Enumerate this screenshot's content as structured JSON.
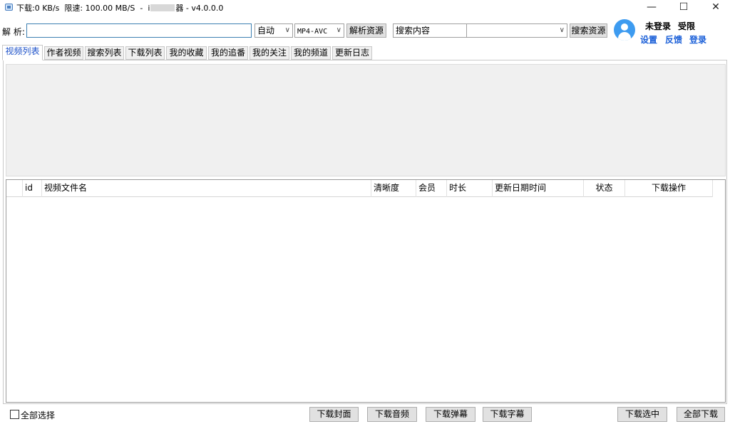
{
  "titlebar": {
    "download_label": "下载:0 KB/s",
    "limit_label": "限速: 100.00 MB/S",
    "sep": "-",
    "name_prefix": "i",
    "name_suffix": "器",
    "version": "- v4.0.0.0",
    "minimize_glyph": "—",
    "maximize_glyph": "☐",
    "close_glyph": "✕"
  },
  "parse": {
    "label": "解 析:",
    "url_value": "",
    "mode_value": "自动",
    "format_value": "MP4-AVC",
    "parse_button": "解析资源"
  },
  "search": {
    "label": "搜索内容",
    "input_value": "",
    "button": "搜索资源"
  },
  "user": {
    "status": "未登录",
    "limit_status": "受限",
    "settings_link": "设置",
    "feedback_link": "反馈",
    "login_link": "登录"
  },
  "tabs": [
    {
      "label": "视频列表",
      "active": true
    },
    {
      "label": "作者视频",
      "active": false
    },
    {
      "label": "搜索列表",
      "active": false
    },
    {
      "label": "下载列表",
      "active": false
    },
    {
      "label": "我的收藏",
      "active": false
    },
    {
      "label": "我的追番",
      "active": false
    },
    {
      "label": "我的关注",
      "active": false
    },
    {
      "label": "我的频道",
      "active": false
    },
    {
      "label": "更新日志",
      "active": false
    }
  ],
  "table": {
    "columns": [
      "",
      "id",
      "视频文件名",
      "清晰度",
      "会员",
      "时长",
      "更新日期时间",
      "状态",
      "下载操作"
    ],
    "rows": []
  },
  "footer": {
    "select_all": "全部选择",
    "download_cover": "下载封面",
    "download_audio": "下载音频",
    "download_danmaku": "下载弹幕",
    "download_subtitle": "下载字幕",
    "download_selected": "下载选中",
    "download_all": "全部下载"
  },
  "colors": {
    "active_tab_text": "#1a4fc8",
    "link": "#1a5fd8",
    "avatar": "#3d9bf0"
  }
}
